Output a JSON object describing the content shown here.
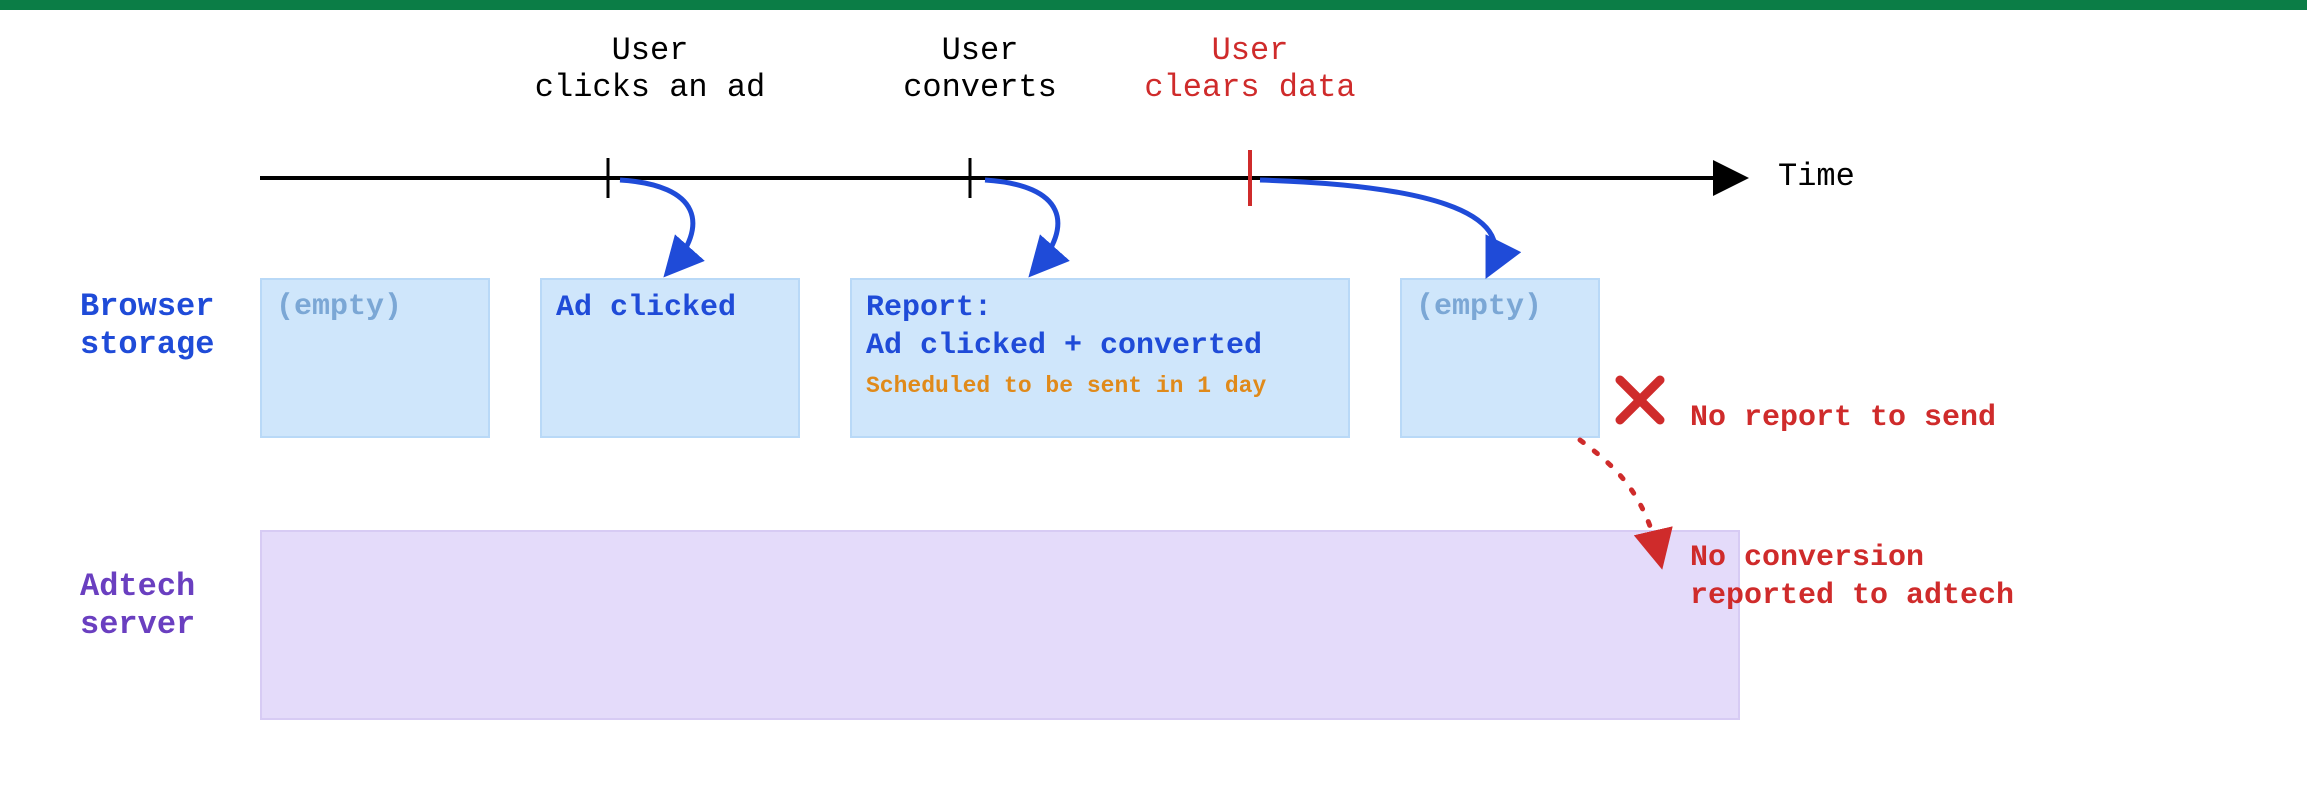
{
  "timeline": {
    "axis_label": "Time",
    "events": [
      {
        "id": "click",
        "label": "User\nclicks an ad",
        "color": "black"
      },
      {
        "id": "convert",
        "label": "User\nconverts",
        "color": "black"
      },
      {
        "id": "clear",
        "label": "User\nclears data",
        "color": "red"
      }
    ]
  },
  "rows": {
    "browser_storage_label": "Browser\nstorage",
    "adtech_server_label": "Adtech\nserver"
  },
  "storage_states": [
    {
      "id": "s0",
      "empty": true,
      "empty_label": "(empty)"
    },
    {
      "id": "s1",
      "empty": false,
      "title": "Ad clicked"
    },
    {
      "id": "s2",
      "empty": false,
      "title": "Report:\nAd clicked + converted",
      "sub": "Scheduled to be sent in 1 day"
    },
    {
      "id": "s3",
      "empty": true,
      "empty_label": "(empty)"
    }
  ],
  "errors": {
    "no_report_label": "No report to send",
    "no_conversion_label": "No conversion\nreported to adtech"
  }
}
